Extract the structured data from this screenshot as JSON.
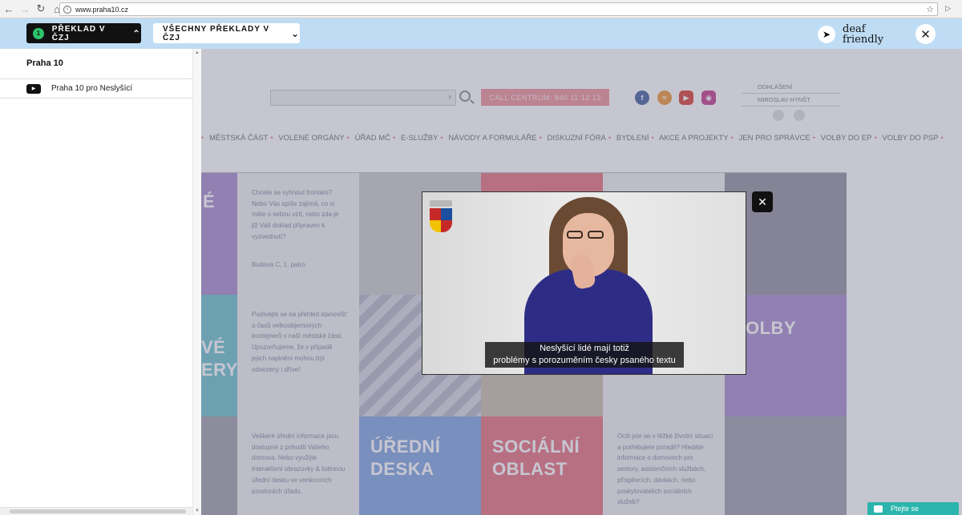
{
  "browser": {
    "url": "www.praha10.cz",
    "back_icon": "arrow-left-icon",
    "forward_icon": "arrow-right-icon",
    "reload_icon": "reload-icon",
    "home_icon": "home-icon",
    "bookmark_icon": "star-icon"
  },
  "deaf_bar": {
    "primary_count": "1",
    "primary_label": "PŘEKLAD V ČZJ",
    "secondary_label": "VŠECHNY PŘEKLADY V ČZJ",
    "logo_line1": "deaf",
    "logo_line2": "friendly",
    "background": "#bfdcf5"
  },
  "sidebar": {
    "title": "Praha 10",
    "items": [
      {
        "label": "Praha 10 pro Neslyšící",
        "icon": "play-icon"
      }
    ]
  },
  "site": {
    "call_center": "CALL CENTRUM: 840 11 12 13",
    "login": [
      "ODHLÁŠENÍ",
      "MIROSLAV HYNŠT"
    ],
    "social_icons": [
      "facebook-icon",
      "rss-icon",
      "youtube-icon",
      "instagram-icon"
    ],
    "menu": [
      "MĚSTSKÁ ČÁST",
      "VOLENÉ ORGÁNY",
      "ÚŘAD MČ",
      "E-SLUŽBY",
      "NÁVODY A FORMULÁŘE",
      "DISKUZNÍ FÓRA",
      "BYDLENÍ",
      "AKCE A PROJEKTY",
      "JEN PRO SPRÁVCE",
      "VOLBY DO EP",
      "VOLBY DO PSP"
    ],
    "tiles": {
      "t1_text": "Chcete se vyhnout frontám? Nebo Vás spíše zajímá, co si máte s sebou vzít, nebo zda je již Váš doklad připraven k vyzvednutí?",
      "t1_sub": "Budova C, 1. patro",
      "t2_text": "Podívejte se na přehled stanovišť a časů velkoobjemových kontejnerů v naší městské části. Upozorňujeme, že v případě jejich naplnění mohou být odvezeny i dříve!",
      "t3_text": "Veškeré úřední informace jsou dostupné z pohodlí Vašeho domova. Nebo využijte interaktivní obrazovky & listinnou úřední desku ve venkovních prostorách úřadu.",
      "t4_text": "Octli jste se v těžké životní situaci a potřebujete poradit? Hledáte informace o domovech pro seniory, asistenčních službách, příspěvcích, dávkách, nebo poskytovatelích sociálních služeb?",
      "title_edge1": "É",
      "title_edge2a": "VÉ",
      "title_edge2b": "ERY",
      "title_uredni_1": "ÚŘEDNÍ",
      "title_uredni_2": "DESKA",
      "title_socialni_1": "SOCIÁLNÍ",
      "title_socialni_2": "OBLAST",
      "title_volby": "OLBY"
    }
  },
  "video": {
    "subtitle_line1": "Neslyšící lidé mají totiž",
    "subtitle_line2": "problémy s porozuměním česky psaného textu"
  },
  "chat": {
    "label": "Ptejte se"
  }
}
